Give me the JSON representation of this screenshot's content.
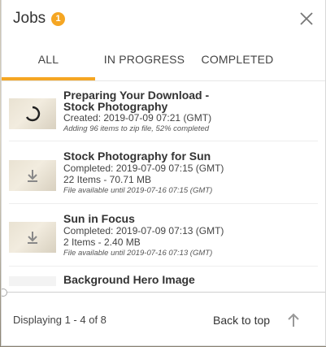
{
  "header": {
    "title": "Jobs",
    "badge_count": "1",
    "close_icon": "close-icon"
  },
  "tabs": [
    {
      "label": "ALL",
      "active": true
    },
    {
      "label": "IN PROGRESS",
      "active": false
    },
    {
      "label": "COMPLETED",
      "active": false
    }
  ],
  "jobs": [
    {
      "title_line1": "Preparing Your Download -",
      "title_line2": "Stock Photography",
      "line1": "Created: 2019-07-09 07:21 (GMT)",
      "note": "Adding 96 items to zip file, 52% completed",
      "icon": "spinner-icon"
    },
    {
      "title_line1": "Stock Photography for Sun",
      "line1": "Completed: 2019-07-09 07:15 (GMT)",
      "line2": "22 Items - 70.71 MB",
      "note": "File available until 2019-07-16 07:15 (GMT)",
      "icon": "download-icon"
    },
    {
      "title_line1": "Sun in Focus",
      "line1": "Completed: 2019-07-09 07:13 (GMT)",
      "line2": "2 Items - 2.40 MB",
      "note": "File available until 2019-07-16 07:13 (GMT)",
      "icon": "download-icon"
    },
    {
      "title_line1": "Background Hero Image"
    }
  ],
  "footer": {
    "displaying": "Displaying 1 - 4 of 8",
    "back_to_top": "Back to top"
  },
  "colors": {
    "accent": "#f5a623"
  }
}
